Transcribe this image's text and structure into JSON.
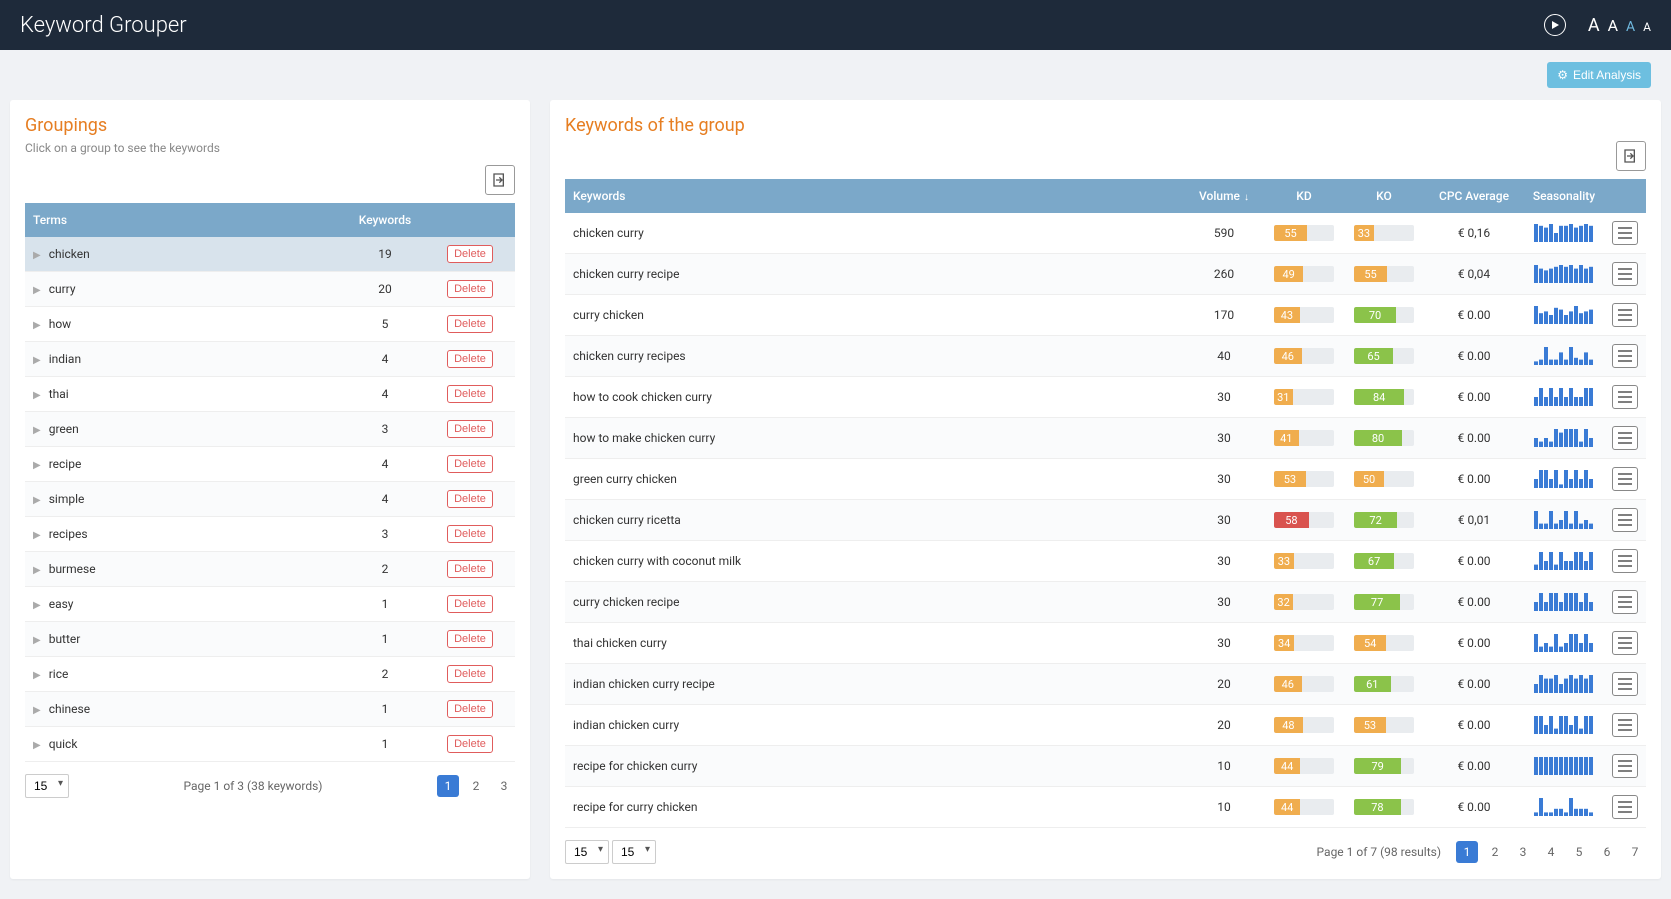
{
  "app": {
    "title": "Keyword Grouper"
  },
  "font_sizes": [
    "A",
    "A",
    "A",
    "A"
  ],
  "edit_button": "Edit Analysis",
  "groupings": {
    "title": "Groupings",
    "subtitle": "Click on a group to see the keywords",
    "columns": {
      "terms": "Terms",
      "keywords": "Keywords"
    },
    "delete_label": "Delete",
    "rows": [
      {
        "term": "chicken",
        "count": 19,
        "selected": true
      },
      {
        "term": "curry",
        "count": 20
      },
      {
        "term": "how",
        "count": 5
      },
      {
        "term": "indian",
        "count": 4
      },
      {
        "term": "thai",
        "count": 4
      },
      {
        "term": "green",
        "count": 3
      },
      {
        "term": "recipe",
        "count": 4
      },
      {
        "term": "simple",
        "count": 4
      },
      {
        "term": "recipes",
        "count": 3
      },
      {
        "term": "burmese",
        "count": 2
      },
      {
        "term": "easy",
        "count": 1
      },
      {
        "term": "butter",
        "count": 1
      },
      {
        "term": "rice",
        "count": 2
      },
      {
        "term": "chinese",
        "count": 1
      },
      {
        "term": "quick",
        "count": 1
      }
    ],
    "page_size": "15",
    "page_info": "Page 1 of 3 (38 keywords)",
    "pages": [
      "1",
      "2",
      "3"
    ],
    "active_page": 0
  },
  "keywords": {
    "title": "Keywords of the group",
    "columns": {
      "keywords": "Keywords",
      "volume": "Volume",
      "kd": "KD",
      "ko": "KO",
      "cpc": "CPC Average",
      "seasonality": "Seasonality"
    },
    "rows": [
      {
        "kw": "chicken curry",
        "vol": 590,
        "kd": 55,
        "ko": 33,
        "cpc": "€ 0,16",
        "spark": [
          10,
          9,
          8,
          10,
          5,
          9,
          9,
          10,
          8,
          9,
          10,
          9
        ]
      },
      {
        "kw": "chicken curry recipe",
        "vol": 260,
        "kd": 49,
        "ko": 55,
        "cpc": "€ 0,04",
        "spark": [
          10,
          8,
          7,
          8,
          9,
          10,
          9,
          10,
          8,
          10,
          8,
          9
        ]
      },
      {
        "kw": "curry chicken",
        "vol": 170,
        "kd": 43,
        "ko": 70,
        "cpc": "€ 0.00",
        "spark": [
          10,
          6,
          7,
          5,
          9,
          8,
          5,
          7,
          10,
          6,
          7,
          8
        ]
      },
      {
        "kw": "chicken curry recipes",
        "vol": 40,
        "kd": 46,
        "ko": 65,
        "cpc": "€ 0.00",
        "spark": [
          2,
          3,
          10,
          3,
          3,
          7,
          3,
          10,
          4,
          3,
          7,
          3
        ]
      },
      {
        "kw": "how to cook chicken curry",
        "vol": 30,
        "kd": 31,
        "ko": 84,
        "cpc": "€ 0.00",
        "spark": [
          5,
          10,
          5,
          10,
          5,
          10,
          5,
          10,
          5,
          5,
          10,
          10
        ]
      },
      {
        "kw": "how to make chicken curry",
        "vol": 30,
        "kd": 41,
        "ko": 80,
        "cpc": "€ 0.00",
        "spark": [
          5,
          3,
          5,
          3,
          10,
          8,
          10,
          10,
          10,
          3,
          10,
          5
        ]
      },
      {
        "kw": "green curry chicken",
        "vol": 30,
        "kd": 53,
        "ko": 50,
        "cpc": "€ 0.00",
        "spark": [
          5,
          10,
          10,
          5,
          10,
          2,
          10,
          5,
          10,
          5,
          10,
          5
        ]
      },
      {
        "kw": "chicken curry ricetta",
        "vol": 30,
        "kd": 58,
        "ko": 72,
        "cpc": "€ 0,01",
        "spark": [
          10,
          3,
          3,
          10,
          3,
          5,
          10,
          3,
          10,
          3,
          5,
          3
        ]
      },
      {
        "kw": "chicken curry with coconut milk",
        "vol": 30,
        "kd": 33,
        "ko": 67,
        "cpc": "€ 0.00",
        "spark": [
          3,
          10,
          5,
          10,
          3,
          10,
          5,
          5,
          10,
          10,
          5,
          10
        ]
      },
      {
        "kw": "curry chicken recipe",
        "vol": 30,
        "kd": 32,
        "ko": 77,
        "cpc": "€ 0.00",
        "spark": [
          5,
          10,
          5,
          10,
          10,
          5,
          10,
          10,
          10,
          5,
          10,
          5
        ]
      },
      {
        "kw": "thai chicken curry",
        "vol": 30,
        "kd": 34,
        "ko": 54,
        "cpc": "€ 0.00",
        "spark": [
          10,
          3,
          5,
          3,
          10,
          3,
          5,
          10,
          10,
          5,
          10,
          5
        ]
      },
      {
        "kw": "indian chicken curry recipe",
        "vol": 20,
        "kd": 46,
        "ko": 61,
        "cpc": "€ 0.00",
        "spark": [
          5,
          10,
          8,
          8,
          10,
          5,
          8,
          10,
          8,
          10,
          8,
          10
        ]
      },
      {
        "kw": "indian chicken curry",
        "vol": 20,
        "kd": 48,
        "ko": 53,
        "cpc": "€ 0.00",
        "spark": [
          10,
          10,
          5,
          10,
          3,
          10,
          10,
          5,
          10,
          3,
          10,
          10
        ]
      },
      {
        "kw": "recipe for chicken curry",
        "vol": 10,
        "kd": 44,
        "ko": 79,
        "cpc": "€ 0.00",
        "spark": [
          10,
          10,
          10,
          10,
          10,
          10,
          10,
          10,
          10,
          10,
          10,
          10
        ]
      },
      {
        "kw": "recipe for curry chicken",
        "vol": 10,
        "kd": 44,
        "ko": 78,
        "cpc": "€ 0.00",
        "spark": [
          2,
          10,
          2,
          2,
          4,
          4,
          2,
          10,
          4,
          4,
          4,
          2
        ]
      }
    ],
    "page_sizes": [
      "15",
      "15"
    ],
    "page_info": "Page 1 of 7 (98 results)",
    "pages": [
      "1",
      "2",
      "3",
      "4",
      "5",
      "6",
      "7"
    ],
    "active_page": 0
  },
  "colors": {
    "kd_low": "#f0ad4e",
    "kd_high": "#d9534f",
    "ko_low": "#f0ad4e",
    "ko_high": "#8bc34a"
  }
}
